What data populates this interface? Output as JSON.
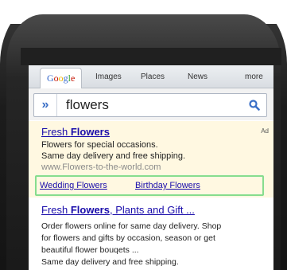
{
  "tabs": {
    "logo": [
      "G",
      "o",
      "o",
      "g",
      "l",
      "e"
    ],
    "images": "Images",
    "places": "Places",
    "news": "News",
    "more": "more"
  },
  "search": {
    "expand_label": "»",
    "query": "flowers"
  },
  "ad": {
    "title_prefix": "Fresh ",
    "title_bold": "Flowers",
    "label": "Ad",
    "line1": "Flowers for special occasions.",
    "line2": "Same day delivery and free shipping.",
    "url": "www.Flowers-to-the-world.com",
    "sitelinks": [
      "Wedding Flowers",
      "Birthday Flowers"
    ]
  },
  "result": {
    "title_prefix": "Fresh ",
    "title_bold": "Flowers",
    "title_suffix": ", Plants and Gift ...",
    "lines": [
      "Order flowers online for same day delivery. Shop",
      "for flowers and gifts by occasion, season or get",
      "beautiful flower bouqets ...",
      "Same day delivery and free shipping."
    ]
  }
}
